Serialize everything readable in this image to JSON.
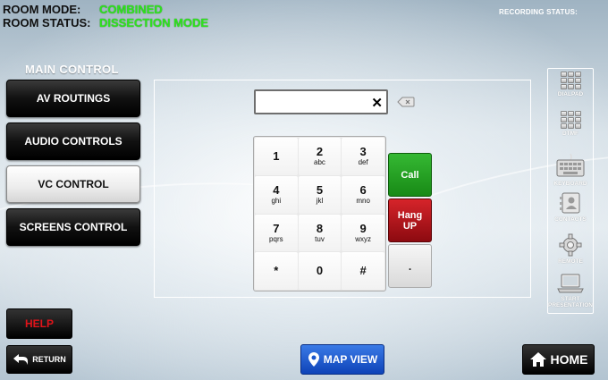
{
  "header": {
    "room_mode_label": "ROOM MODE:",
    "room_mode_value": "COMBINED",
    "room_status_label": "ROOM STATUS:",
    "room_status_value": "DISSECTION MODE",
    "recording_status_label": "RECORDING STATUS:"
  },
  "main_control": {
    "title": "MAIN CONTROL",
    "items": [
      {
        "label": "AV ROUTINGS",
        "active": false
      },
      {
        "label": "AUDIO CONTROLS",
        "active": false
      },
      {
        "label": "VC CONTROL",
        "active": true
      },
      {
        "label": "SCREENS CONTROL",
        "active": false
      }
    ]
  },
  "dialer": {
    "input_value": "",
    "clear_glyph": "✕",
    "keys": [
      {
        "num": "1",
        "letters": ""
      },
      {
        "num": "2",
        "letters": "abc"
      },
      {
        "num": "3",
        "letters": "def"
      },
      {
        "num": "4",
        "letters": "ghi"
      },
      {
        "num": "5",
        "letters": "jkl"
      },
      {
        "num": "6",
        "letters": "mno"
      },
      {
        "num": "7",
        "letters": "pqrs"
      },
      {
        "num": "8",
        "letters": "tuv"
      },
      {
        "num": "9",
        "letters": "wxyz"
      },
      {
        "num": "*",
        "letters": ""
      },
      {
        "num": "0",
        "letters": ""
      },
      {
        "num": "#",
        "letters": ""
      }
    ],
    "call_label": "Call",
    "hangup_label_1": "Hang",
    "hangup_label_2": "UP",
    "dot_label": "."
  },
  "right_bar": {
    "items": [
      {
        "label": "DIALPAD",
        "icon": "dialpad-icon"
      },
      {
        "label": "DTMF",
        "icon": "dtmf-icon"
      },
      {
        "label": "KEYBOARD",
        "icon": "keyboard-icon"
      },
      {
        "label": "CONTACTS",
        "icon": "contacts-icon"
      },
      {
        "label": "REMOTE",
        "icon": "gear-icon"
      },
      {
        "label": "START PRESENTATION",
        "icon": "laptop-icon"
      }
    ]
  },
  "footer": {
    "help_label": "HELP",
    "return_label": "RETURN",
    "map_view_label": "MAP VIEW",
    "home_label": "HOME"
  },
  "colors": {
    "status_green": "#2fe31e",
    "call_green": "#188a16",
    "hangup_red": "#8c0a10",
    "help_red": "#e0141a",
    "map_blue": "#0e43b8"
  }
}
